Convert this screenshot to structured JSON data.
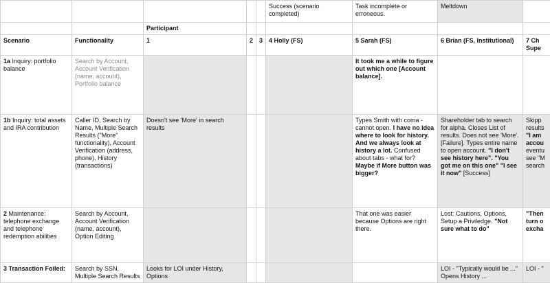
{
  "legend": {
    "success": "Success (scenario completed)",
    "task_incomplete": "Task incomplete or erroneous.",
    "meltdown": "Meltdown"
  },
  "participant_header": "Participant",
  "headers": {
    "scenario": "Scenario",
    "functionality": "Functionality",
    "p1": "1",
    "p2": "2",
    "p3": "3",
    "p4": "4 Holly (FS)",
    "p5": "5 Sarah (FS)",
    "p6": "6 Brian (FS, Institutional)",
    "p7": "7 Ch Supe"
  },
  "rows": [
    {
      "id": "1a",
      "scenario": "Inquiry: portfolio balance",
      "functionality": "Search by Account, Account Verification (name, account), Portfolio balance",
      "p5": "It took me a while to figure out which one [Account balance]."
    },
    {
      "id": "1b",
      "scenario": "Inquiry: total assets and IRA contribution",
      "functionality": "Caller ID, Search by Name, Multiple Search Results (\"More\" functionality), Account Verification (address, phone), History (transactions)",
      "p1": "Doesn't see 'More' in search results",
      "p5_a": "Types Smith with coma - cannot open.",
      "p5_b": "I have no idea where to look for history. And we always look at history a lot.",
      "p5_c": "Confused about tabs - what for?",
      "p5_d": "Maybe if More button was bigger?",
      "p6_a": "Shareholder tab to search for alpha. Closes List of results. Does not see 'More'. [Failure]. Types entire name to open account.",
      "p6_b": "\"I don't see history here\".",
      "p6_c": "\"You got me on this one\"",
      "p6_d": "\"I see it now\"",
      "p6_e": "[Success]",
      "p7_a": "Skipp results",
      "p7_b": "\"I am accou",
      "p7_c": "eventu see \"M search"
    },
    {
      "id": "2",
      "scenario": "Maintenance: telephone exchange and telephone redemption abilities",
      "functionality": "Search by Account, Account Verification (name, account), Option Editing",
      "p5": "That one was easier because Options are right there.",
      "p6_a": "Lost: Cautions, Options, Setup a Priviledge.",
      "p6_b": "\"Not sure what to do\"",
      "p7_a": "\"Then turn o excha"
    },
    {
      "id": "3",
      "scenario": "Transaction Foiled:",
      "functionality": "Search by SSN, Multiple Search Results",
      "p1": "Looks for LOI under History, Options",
      "p6": "LOI - \"Typically would be ...\" Opens History ...",
      "p7": "LOI - \""
    }
  ]
}
